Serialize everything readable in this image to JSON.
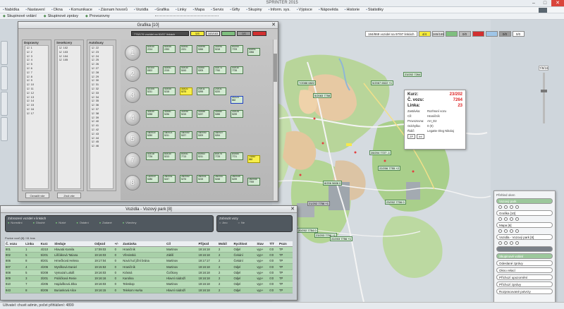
{
  "window": {
    "title": "SPRINTER 2015",
    "min": "–",
    "max": "□",
    "close": "✕"
  },
  "menu": [
    "Nabídka",
    "Nastavení",
    "Okna",
    "Komunikace",
    "Zásnam hovorů",
    "Vozidla",
    "Grafika",
    "Linky",
    "Mapa",
    "Servis",
    "Gifty",
    "Skupiny",
    "Inform. sys.",
    "Výpisce",
    "Nápověda",
    "Historie",
    "Statistiky"
  ],
  "toolbar": [
    "Skupinové volání",
    "Skupinové zprávy",
    "Provozovny"
  ],
  "grafika": {
    "title": "Grafika [10]",
    "close": "✕",
    "info": "776/176 vozidel na 61/57 linkách",
    "swatches": [
      {
        "label": "5/5",
        "color": "#f6ec3a"
      },
      {
        "label": "163/163",
        "color": "#e4e4e4"
      },
      {
        "label": "",
        "color": "#7fbf7f"
      },
      {
        "label": "0/0",
        "color": "#9a9a9a"
      },
      {
        "label": "",
        "color": "#d23030"
      }
    ],
    "filters": [
      {
        "title": "Dopravny",
        "items": [
          "1",
          "2",
          "3",
          "4",
          "5",
          "6",
          "7",
          "8",
          "9",
          "10",
          "11",
          "12",
          "13",
          "14",
          "15",
          "16",
          "17"
        ]
      },
      {
        "title": "Sesekcery",
        "items": [
          "102",
          "103",
          "104",
          "105"
        ]
      },
      {
        "title": "Autobusy",
        "items": [
          "22",
          "23",
          "24",
          "25",
          "26",
          "27",
          "28",
          "29",
          "30",
          "31",
          "32",
          "33",
          "34",
          "35",
          "36",
          "37",
          "38",
          "39",
          "40",
          "41",
          "42",
          "43",
          "44",
          "45",
          "46"
        ]
      }
    ],
    "buttons": [
      "Označit vše",
      "Zruš vše"
    ],
    "rows": [
      {
        "num": "1",
        "boxes": [
          "6/2030\n2214",
          "5/2045\n2253",
          "5/2051\n2221",
          "5/2095\n5266",
          "3/2094\n5218",
          "5/2200\n7709",
          "5/2091\n2266"
        ]
      },
      {
        "num": "2",
        "boxes": [
          "4/2100\n8302",
          "4/2051\n2215",
          "4/2030\n5243",
          "4/2087\n5205",
          "4/2073\n7760",
          "4/2030\n7735"
        ]
      },
      {
        "num": "3",
        "boxes": [
          "4/2105\n5211",
          "4/2045\n5218",
          "Y3/2021\n5275",
          "2/2011\n5295",
          "2/2031\n5220",
          "B3/2123\n862"
        ]
      },
      {
        "num": "4",
        "boxes": [
          "3/2030\n5258",
          "3/2081\n5236",
          "3/2095\n5215",
          "3/2088\n5237",
          "3/2080\n5288",
          "3/2028\n5239"
        ]
      },
      {
        "num": "5",
        "boxes": [
          "18/2014\n5250",
          "18/2021\n5211",
          "18/2040\n5227",
          "18/2040\n5209",
          "18/2027\n5254"
        ]
      },
      {
        "num": "7",
        "boxes": [
          "5/2018\n7726",
          "8/2030\n5213",
          "8/2051\n7713",
          "8/2063\n5211",
          "8/2075\n7725",
          "8/2084\n7721",
          "Y7/2087\n862"
        ]
      },
      {
        "num": "8",
        "boxes": [
          "13/2019\n5286",
          "26/2041\n5247",
          "26/2040\n5276",
          "26/2031\n5215",
          "26/2047\n5248",
          "26/2039\n5239",
          "26/2045\n7769"
        ]
      }
    ]
  },
  "vozidla": {
    "title": "Vozidla - Vozový park [8]",
    "close": "✕",
    "group1": {
      "title": "Zobrazení vozidel v linkách",
      "options": [
        "Normální",
        "Dlouhé",
        "Nízké",
        "Ostatní",
        "Zadané",
        "Všechny"
      ]
    },
    "group2": {
      "title": "Zobrazit vozy",
      "options": [
        "Ano",
        "Ne"
      ]
    },
    "table_caption": "Pozice vozů [8] / 61 tras",
    "columns": [
      "Č. vozu",
      "Linka",
      "Kurz",
      "Sleduje",
      "Odjezd",
      "+/-",
      "Zastávka",
      "Cíl",
      "Příjezd",
      "Mobil",
      "Rychlost",
      "Stav",
      "T/T",
      "Pozn"
    ],
    "rows": [
      [
        "801",
        "1",
        "4/210",
        "Hlavatá Kamila",
        "17:09:03",
        "0",
        "Hraničník",
        "Martinov",
        "19:16:18",
        "2",
        "Odjel",
        "vyp+",
        "0:0",
        "TP"
      ],
      [
        "802",
        "5",
        "5/201",
        "Liščáková Tatiana",
        "19:16:03",
        "0",
        "Vřesinská",
        "Zátiší",
        "19:16:18",
        "2",
        "Čekání",
        "vyp+",
        "0:0",
        "TP"
      ],
      [
        "806",
        "8",
        "8/201",
        "Hrnečková Helena",
        "19:17:04",
        "0",
        "Nová huť jižní brána",
        "Martinov",
        "19:17:17",
        "2",
        "Čekání",
        "vyp+",
        "0:0",
        "TP"
      ],
      [
        "807",
        "4",
        "4/206",
        "Myslíková Daniel",
        "19:15:53",
        "0",
        "Hraničník",
        "Martinov",
        "19:16:18",
        "2",
        "Odjel",
        "vyp+",
        "0:0",
        "TP"
      ],
      [
        "808",
        "5",
        "5/208",
        "Vymazal Lukáš",
        "19:16:03",
        "0",
        "Krásná",
        "Čočkovy",
        "19:16:18",
        "2",
        "Odjel",
        "vyp+",
        "0:0",
        "TP"
      ],
      [
        "809",
        "3",
        "3/201",
        "Poláčková Renie",
        "19:16:16",
        "0",
        "Karolina",
        "Hlavní nádraží",
        "19:16:18",
        "2",
        "Odjel",
        "vyp+",
        "0:0",
        "TP"
      ],
      [
        "810",
        "7",
        "4/205",
        "Hajdušková Jitka",
        "19:16:03",
        "0",
        "Teleskop",
        "Martinov",
        "19:16:18",
        "2",
        "Odjel",
        "vyp+",
        "0:0",
        "TP"
      ],
      [
        "843",
        "8",
        "8/206",
        "Burianková Alice",
        "19:16:15",
        "0",
        "Telekom Hurka",
        "Hlavní nádraží",
        "19:16:18",
        "2",
        "Odjel",
        "vyp+",
        "0:0",
        "TP"
      ]
    ]
  },
  "map": {
    "status_text": "184/869 vozidel na 97/97 linkách",
    "swatches": [
      {
        "label": "4/4",
        "color": "#f6ec3a"
      },
      {
        "label": "165/165",
        "color": "#e4e4e4"
      },
      {
        "label": "",
        "color": "#7fbf7f"
      },
      {
        "label": "0/0",
        "color": "#bcbcbc"
      },
      {
        "label": "",
        "color": "#d23030"
      },
      {
        "label": "",
        "color": "#9fc5e8"
      },
      {
        "label": "0/0",
        "color": "#9a9a9a"
      },
      {
        "label": "0/0",
        "color": "#ffffff"
      }
    ],
    "zoom_label": "7/8/16",
    "vehicles": [
      {
        "text": "23/202\n7264",
        "gray": false
      },
      {
        "text": "5/2067\n6522 +1",
        "gray": false
      },
      {
        "text": "28/204\n7727 -1",
        "gray": false
      },
      {
        "text": "22/206\n7755 +2",
        "gray": false
      },
      {
        "text": "8/206\n5606 0",
        "gray": false
      },
      {
        "text": "23/202\n7706 0",
        "gray": false
      },
      {
        "text": "21/202\n7756 +1",
        "gray": true
      },
      {
        "text": "20/202\n7754 0",
        "gray": false
      },
      {
        "text": "23/203\n7706 +1",
        "gray": false
      },
      {
        "text": "22/203\n7756 +1",
        "gray": false
      },
      {
        "text": "7/2088\n6822",
        "gray": false
      },
      {
        "text": "5/2083\n7758",
        "gray": false
      }
    ]
  },
  "popup": {
    "kurz_label": "Kurz:",
    "kurz_value": "23/202",
    "vozu_label": "Č. vozu:",
    "vozu_value": "7264",
    "linka_label": "Linka:",
    "linka_value": "23",
    "details": [
      {
        "k": "Zastávka:",
        "v": "Rozhraní vozu"
      },
      {
        "k": "Cíl:",
        "v": "Hraničník"
      },
      {
        "k": "Provozovna:",
        "v": "AH_D2"
      },
      {
        "k": "Odchylka:",
        "v": "0 (0)"
      },
      {
        "k": "Řidič:",
        "v": "Legatte Oleg Nikolaj"
      }
    ],
    "buttons": [
      "ZP",
      "Inf"
    ]
  },
  "rpanel": {
    "header": "Přehled oken",
    "items": [
      {
        "label": "Vozový park",
        "style": "green"
      },
      {
        "label": "Grafika [10]",
        "style": ""
      },
      {
        "label": "Mapa [6]",
        "style": ""
      },
      {
        "label": "Vozidla - Vozový park [8]",
        "style": ""
      },
      {
        "label": "",
        "style": "dark"
      },
      {
        "label": "Skupinové volání",
        "style": "green"
      },
      {
        "label": "Odeslané zprávy",
        "style": ""
      },
      {
        "label": "Okno relací",
        "style": ""
      },
      {
        "label": "Příchozí upozornění",
        "style": ""
      },
      {
        "label": "Příchozí zprávy",
        "style": ""
      },
      {
        "label": "Rozpracované potvrzy",
        "style": ""
      }
    ]
  },
  "statusbar": {
    "text": "Uživatel: chuvit admin, počet přihlášení: 4899"
  }
}
